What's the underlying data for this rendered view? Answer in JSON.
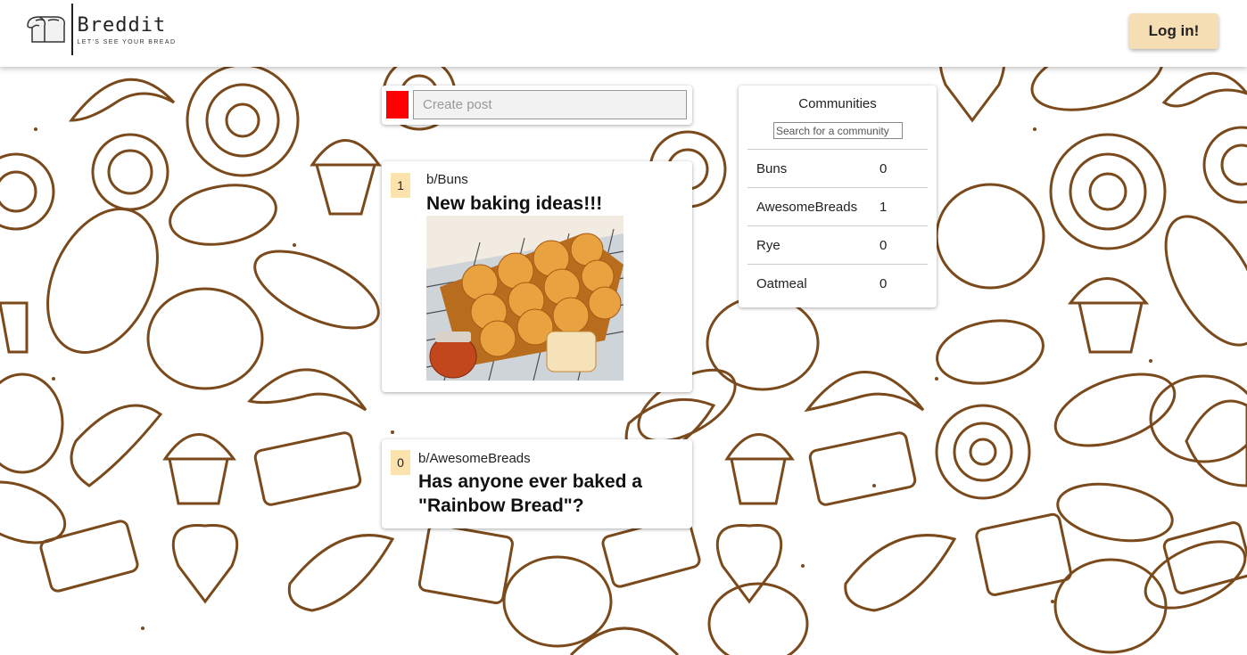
{
  "app": {
    "name": "Breddit",
    "tagline": "LET'S SEE YOUR BREAD",
    "login_label": "Log in!"
  },
  "create_post": {
    "placeholder": "Create post",
    "avatar_color": "#ff0000"
  },
  "posts": [
    {
      "votes": "1",
      "subreddit": "b/Buns",
      "title": "New baking ideas!!!",
      "has_image": true
    },
    {
      "votes": "0",
      "subreddit": "b/AwesomeBreads",
      "title": "Has anyone ever baked a \"Rainbow Bread\"?",
      "has_image": false
    }
  ],
  "communities": {
    "title": "Communities",
    "search_placeholder": "Search for a community",
    "items": [
      {
        "name": "Buns",
        "count": "0"
      },
      {
        "name": "AwesomeBreads",
        "count": "1"
      },
      {
        "name": "Rye",
        "count": "0"
      },
      {
        "name": "Oatmeal",
        "count": "0"
      }
    ]
  },
  "colors": {
    "accent": "#f5deb3",
    "vote_bg": "#fce3ae",
    "sketch": "#7a4a1c"
  }
}
